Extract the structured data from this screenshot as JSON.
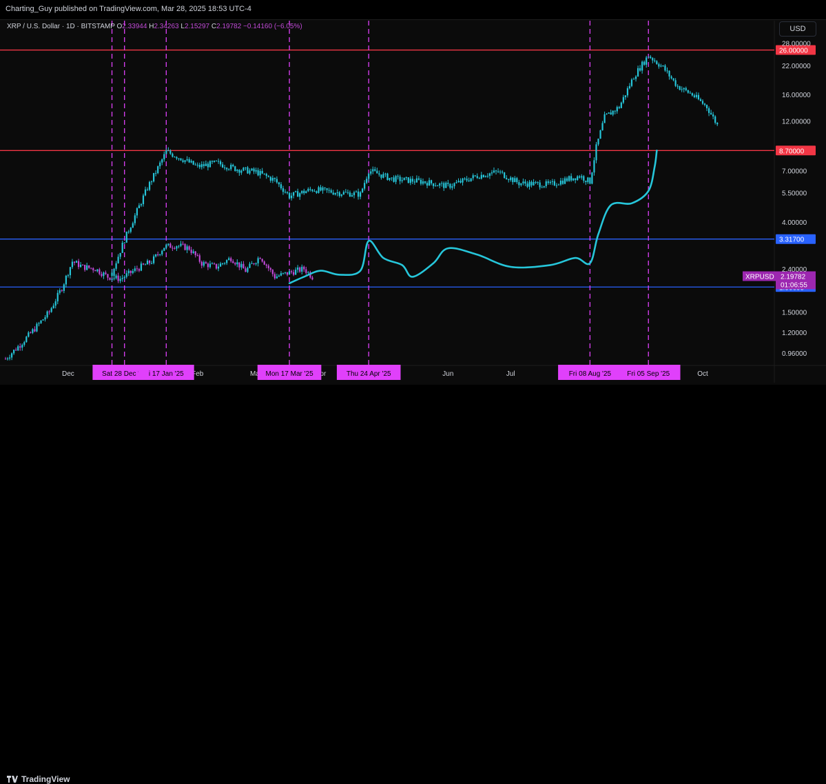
{
  "header": {
    "published_by": "Charting_Guy published on TradingView.com, Mar 28, 2025 18:53 UTC-4"
  },
  "legend": {
    "symbol": "XRP / U.S. Dollar · 1D · BITSTAMP",
    "open_label": "O",
    "open": "2.33944",
    "high_label": "H",
    "high": "2.34263",
    "low_label": "L",
    "low": "2.15297",
    "close_label": "C",
    "close": "2.19782",
    "change": "−0.14160 (−6.05%)"
  },
  "currency_button": "USD",
  "footer": {
    "brand": "TradingView"
  },
  "colors": {
    "up_candle": "#26c6da",
    "down_candle": "#c04ad6",
    "projection": "#26c6da",
    "resistance_line": "#f23645",
    "support_line": "#2962ff",
    "vertical_marker": "#e040fb",
    "price_badge": "#9c27b0"
  },
  "chart_data": {
    "type": "line",
    "y_scale": "log",
    "ylim": [
      0.85,
      29
    ],
    "y_ticks": [
      "28.00000",
      "22.00000",
      "16.00000",
      "12.00000",
      "8.70000",
      "7.00000",
      "5.50000",
      "4.00000",
      "3.31700",
      "2.40000",
      "1.96695",
      "1.50000",
      "1.20000",
      "0.96000"
    ],
    "y_tick_values": [
      28,
      22,
      16,
      12,
      8.7,
      7,
      5.5,
      4,
      3.317,
      2.4,
      1.96695,
      1.5,
      1.2,
      0.96
    ],
    "x_ticks": [
      "Dec",
      "Feb",
      "Mar",
      "Apr",
      "Jun",
      "Jul",
      "Oct"
    ],
    "x_tick_dates": [
      "2024-12-01",
      "2025-02-01",
      "2025-03-01",
      "2025-04-01",
      "2025-06-01",
      "2025-07-01",
      "2025-10-01"
    ],
    "horizontal_levels": [
      {
        "label": "26.00000",
        "value": 26.0,
        "kind": "resistance"
      },
      {
        "label": "8.70000",
        "value": 8.7,
        "kind": "resistance"
      },
      {
        "label": "3.31700",
        "value": 3.317,
        "kind": "support"
      },
      {
        "label": "1.96695",
        "value": 1.96695,
        "kind": "support"
      }
    ],
    "current_price": {
      "symbol": "XRPUSD",
      "value": "2.19782",
      "countdown": "01:06:55"
    },
    "vertical_markers": [
      {
        "date": "2024-12-22",
        "label": ""
      },
      {
        "date": "2024-12-28",
        "label": "Sat 28 Dec '24"
      },
      {
        "date": "2025-01-17",
        "label": "i 17 Jan '25"
      },
      {
        "date": "2025-03-17",
        "label": "Mon 17 Mar '25"
      },
      {
        "date": "2025-04-24",
        "label": "Thu 24 Apr '25"
      },
      {
        "date": "2025-08-08",
        "label": "Fri 08 Aug '25"
      },
      {
        "date": "2025-09-05",
        "label": "Fri 05 Sep '25"
      }
    ],
    "series": [
      {
        "name": "",
        "kind": "candles",
        "points": [
          [
            "2024-11-01",
            0.9
          ],
          [
            "2024-11-08",
            1.05
          ],
          [
            "2024-11-15",
            1.25
          ],
          [
            "2024-11-22",
            1.5
          ],
          [
            "2024-11-28",
            1.95
          ],
          [
            "2024-12-03",
            2.6
          ],
          [
            "2024-12-08",
            2.45
          ],
          [
            "2024-12-14",
            2.4
          ],
          [
            "2024-12-20",
            2.2
          ],
          [
            "2024-12-26",
            2.15
          ],
          [
            "2025-01-03",
            2.4
          ],
          [
            "2025-01-10",
            2.6
          ],
          [
            "2025-01-16",
            3.05
          ],
          [
            "2025-01-22",
            3.1
          ],
          [
            "2025-01-28",
            3.0
          ],
          [
            "2025-02-03",
            2.55
          ],
          [
            "2025-02-10",
            2.45
          ],
          [
            "2025-02-17",
            2.7
          ],
          [
            "2025-02-24",
            2.35
          ],
          [
            "2025-03-03",
            2.75
          ],
          [
            "2025-03-10",
            2.2
          ],
          [
            "2025-03-17",
            2.3
          ],
          [
            "2025-03-24",
            2.4
          ],
          [
            "2025-03-28",
            2.2
          ]
        ]
      },
      {
        "name": "",
        "kind": "projection_candles",
        "points": [
          [
            "2024-12-22",
            2.3
          ],
          [
            "2024-12-28",
            3.3
          ],
          [
            "2025-01-03",
            4.5
          ],
          [
            "2025-01-08",
            5.8
          ],
          [
            "2025-01-13",
            7.2
          ],
          [
            "2025-01-17",
            8.6
          ],
          [
            "2025-01-24",
            8.0
          ],
          [
            "2025-02-01",
            7.3
          ],
          [
            "2025-02-10",
            7.6
          ],
          [
            "2025-02-20",
            7.1
          ],
          [
            "2025-03-01",
            6.9
          ],
          [
            "2025-03-10",
            6.3
          ],
          [
            "2025-03-17",
            5.3
          ],
          [
            "2025-03-28",
            5.7
          ],
          [
            "2025-04-10",
            5.5
          ],
          [
            "2025-04-20",
            5.4
          ],
          [
            "2025-04-24",
            7.0
          ],
          [
            "2025-05-05",
            6.4
          ],
          [
            "2025-05-20",
            6.2
          ],
          [
            "2025-06-01",
            5.9
          ],
          [
            "2025-06-15",
            6.6
          ],
          [
            "2025-06-25",
            6.9
          ],
          [
            "2025-07-05",
            6.1
          ],
          [
            "2025-07-20",
            6.0
          ],
          [
            "2025-07-29",
            6.4
          ],
          [
            "2025-08-03",
            6.6
          ],
          [
            "2025-08-08",
            6.2
          ],
          [
            "2025-08-11",
            9.0
          ],
          [
            "2025-08-15",
            12.5
          ],
          [
            "2025-08-22",
            14.0
          ],
          [
            "2025-08-29",
            19.5
          ],
          [
            "2025-09-05",
            24.5
          ],
          [
            "2025-09-12",
            21.5
          ],
          [
            "2025-09-19",
            17.5
          ],
          [
            "2025-09-26",
            16.0
          ],
          [
            "2025-10-03",
            14.0
          ],
          [
            "2025-10-08",
            11.5
          ]
        ]
      },
      {
        "name": "",
        "kind": "projection_line",
        "points": [
          [
            "2025-03-17",
            2.05
          ],
          [
            "2025-03-24",
            2.2
          ],
          [
            "2025-04-01",
            2.35
          ],
          [
            "2025-04-10",
            2.25
          ],
          [
            "2025-04-20",
            2.35
          ],
          [
            "2025-04-24",
            3.25
          ],
          [
            "2025-05-01",
            2.7
          ],
          [
            "2025-05-10",
            2.5
          ],
          [
            "2025-05-15",
            2.2
          ],
          [
            "2025-05-25",
            2.55
          ],
          [
            "2025-06-01",
            3.0
          ],
          [
            "2025-06-15",
            2.8
          ],
          [
            "2025-07-01",
            2.45
          ],
          [
            "2025-07-20",
            2.5
          ],
          [
            "2025-08-01",
            2.7
          ],
          [
            "2025-08-08",
            2.55
          ],
          [
            "2025-08-12",
            3.5
          ],
          [
            "2025-08-18",
            4.8
          ],
          [
            "2025-08-28",
            4.9
          ],
          [
            "2025-09-05",
            5.6
          ],
          [
            "2025-09-08",
            7.3
          ],
          [
            "2025-09-09",
            8.7
          ]
        ]
      }
    ]
  }
}
